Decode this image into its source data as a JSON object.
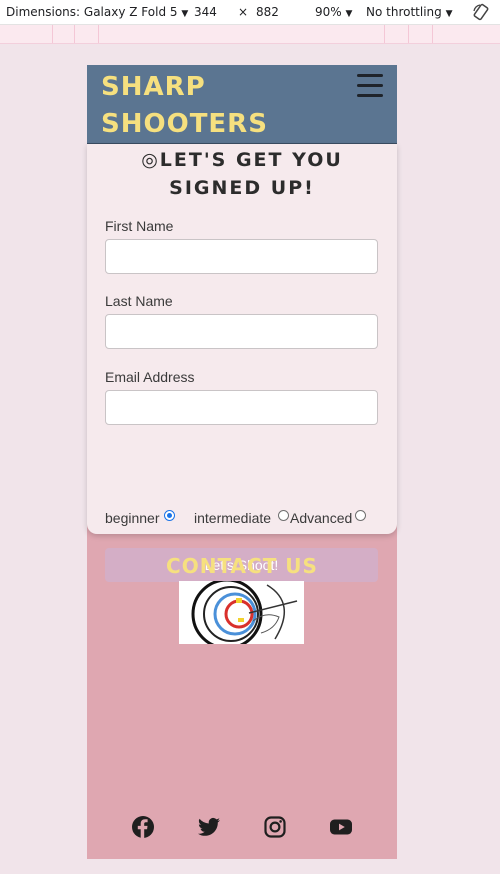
{
  "devtools": {
    "dimensions_label": "Dimensions: Galaxy Z Fold 5",
    "width": "344",
    "times": "×",
    "height": "882",
    "zoom": "90%",
    "throttling": "No throttling"
  },
  "header": {
    "brand_line1": "SHARP",
    "brand_line2": "SHOOTERS",
    "menu_icon": "hamburger-menu-icon"
  },
  "signup": {
    "title_icon": "◎",
    "title_line1": "LET'S GET YOU",
    "title_line2": "SIGNED UP!",
    "first_name_label": "First Name",
    "first_name_value": "",
    "last_name_label": "Last Name",
    "last_name_value": "",
    "email_label": "Email Address",
    "email_value": "",
    "levels": [
      {
        "label": "beginner",
        "selected": true
      },
      {
        "label": "intermediate",
        "selected": false
      },
      {
        "label": "Advanced",
        "selected": false
      }
    ],
    "submit_label": "Let's Shoot!"
  },
  "footer": {
    "contact_title": "CONTACT US",
    "social": [
      "facebook-icon",
      "twitter-icon",
      "instagram-icon",
      "youtube-icon"
    ]
  },
  "colors": {
    "header_bg": "#5b7591",
    "brand_text": "#f6e07f",
    "card_bg": "#f6eaed",
    "footer_bg": "#dfa7b1",
    "button_bg": "#d4aec6"
  }
}
